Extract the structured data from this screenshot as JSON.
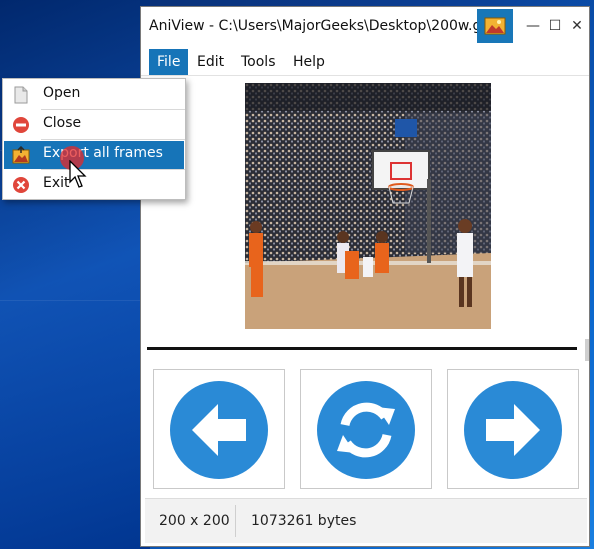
{
  "window": {
    "title": "AniView - C:\\Users\\MajorGeeks\\Desktop\\200w.gif",
    "controls": {
      "minimize": "—",
      "maximize": "☐",
      "close": "✕"
    }
  },
  "menubar": {
    "items": [
      {
        "label": "File",
        "active": true
      },
      {
        "label": "Edit"
      },
      {
        "label": "Tools"
      },
      {
        "label": "Help"
      }
    ]
  },
  "file_menu": {
    "items": [
      {
        "label": "Open",
        "icon": "document-icon"
      },
      {
        "label": "Close",
        "icon": "close-circle-icon"
      },
      {
        "label": "Export all frames",
        "icon": "export-frames-icon",
        "highlighted": true
      },
      {
        "label": "Exit",
        "icon": "exit-circle-icon"
      }
    ]
  },
  "viewer": {
    "image_description": "basketball game animation frame"
  },
  "controls": {
    "previous": "arrow-left-icon",
    "reload": "refresh-icon",
    "next": "arrow-right-icon"
  },
  "status": {
    "dimensions": "200 x 200",
    "size": "1073261 bytes"
  },
  "colors": {
    "accent": "#1674b8",
    "nav_button": "#2a8ad6",
    "close_icon": "#e0463b"
  }
}
